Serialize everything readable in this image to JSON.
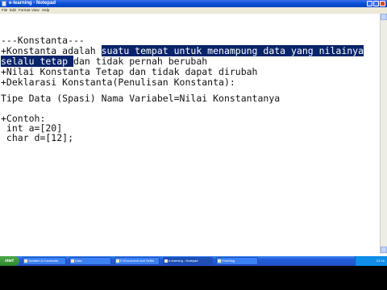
{
  "window": {
    "title": "e-learning - Notepad"
  },
  "menu": {
    "items": [
      "File",
      "Edit",
      "Format",
      "View",
      "Help"
    ]
  },
  "editor": {
    "lines": [
      {
        "pre": "---Konstanta---",
        "hl": "",
        "post": ""
      },
      {
        "pre": "+Konstanta adalah ",
        "hl": "suatu tempat untuk menampung data yang nilainya",
        "post": ""
      },
      {
        "pre": "",
        "hl": "selalu tetap ",
        "post": "dan tidak pernah berubah"
      },
      {
        "pre": "+Nilai Konstanta Tetap dan tidak dapat dirubah",
        "hl": "",
        "post": ""
      },
      {
        "pre": "+Deklarasi Konstanta(Penulisan Konstanta):",
        "hl": "",
        "post": ""
      },
      {
        "pre": "",
        "hl": "",
        "post": ""
      },
      {
        "pre": "Tipe Data (Spasi) Nama Variabel=Nilai Konstantanya",
        "hl": "",
        "post": ""
      },
      {
        "pre": "",
        "hl": "",
        "post": ""
      },
      {
        "pre": "+Contoh:",
        "hl": "",
        "post": ""
      },
      {
        "pre": " int a=[20]",
        "hl": "",
        "post": ""
      },
      {
        "pre": " char d=[12];",
        "hl": "",
        "post": ""
      }
    ]
  },
  "taskbar": {
    "start_label": "start",
    "tasks": [
      {
        "label": "Variabel & Konstanta",
        "active": false
      },
      {
        "label": "Data",
        "active": false
      },
      {
        "label": "E:\\Document and Settin",
        "active": false
      },
      {
        "label": "e-learning - Notepad",
        "active": true
      },
      {
        "label": "FreeMag",
        "active": false
      }
    ],
    "clock": "21:16"
  },
  "colors": {
    "highlight_bg": "#0a246a",
    "titlebar": "#0a4fd6",
    "taskbar": "#245edb"
  }
}
